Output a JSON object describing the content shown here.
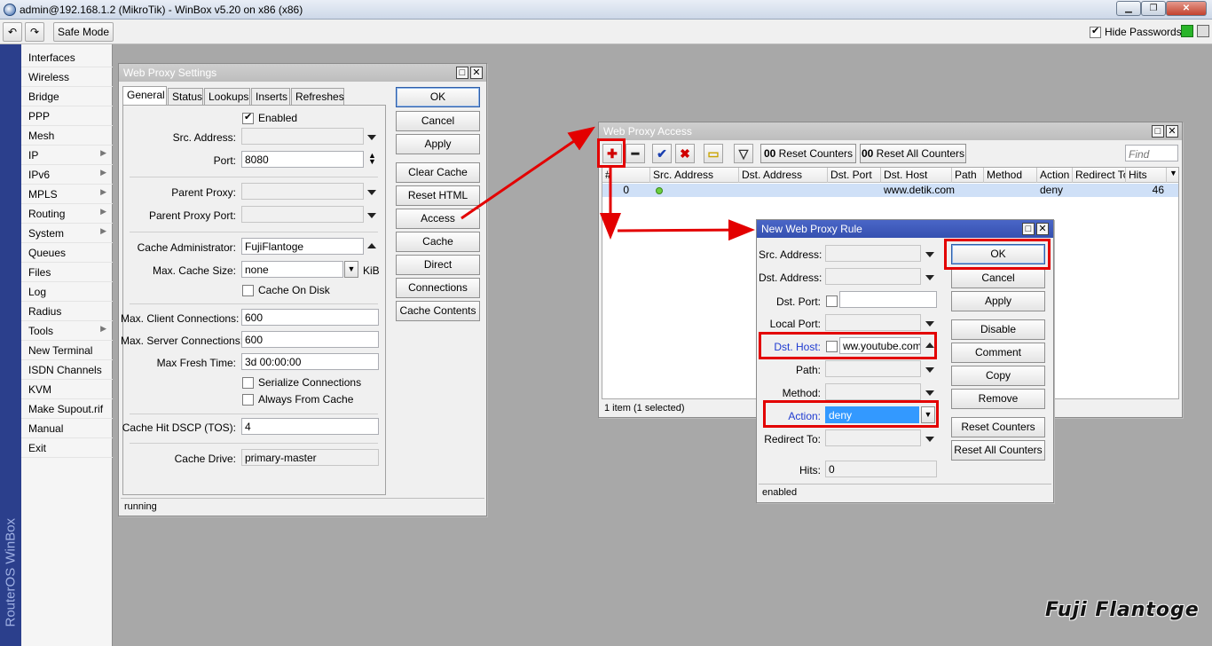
{
  "app": {
    "title": "admin@192.168.1.2 (MikroTik) - WinBox v5.20 on x86 (x86)",
    "safe_mode": "Safe Mode",
    "hide_passwords": "Hide Passwords",
    "hide_passwords_checked": true,
    "vertical_brand": "RouterOS WinBox",
    "watermark": "Fuji Flantoge"
  },
  "sidebar": {
    "items": [
      {
        "label": "Interfaces",
        "submenu": false
      },
      {
        "label": "Wireless",
        "submenu": false
      },
      {
        "label": "Bridge",
        "submenu": false
      },
      {
        "label": "PPP",
        "submenu": false
      },
      {
        "label": "Mesh",
        "submenu": false
      },
      {
        "label": "IP",
        "submenu": true
      },
      {
        "label": "IPv6",
        "submenu": true
      },
      {
        "label": "MPLS",
        "submenu": true
      },
      {
        "label": "Routing",
        "submenu": true
      },
      {
        "label": "System",
        "submenu": true
      },
      {
        "label": "Queues",
        "submenu": false
      },
      {
        "label": "Files",
        "submenu": false
      },
      {
        "label": "Log",
        "submenu": false
      },
      {
        "label": "Radius",
        "submenu": false
      },
      {
        "label": "Tools",
        "submenu": true
      },
      {
        "label": "New Terminal",
        "submenu": false
      },
      {
        "label": "ISDN Channels",
        "submenu": false
      },
      {
        "label": "KVM",
        "submenu": false
      },
      {
        "label": "Make Supout.rif",
        "submenu": false
      },
      {
        "label": "Manual",
        "submenu": false
      },
      {
        "label": "Exit",
        "submenu": false
      }
    ]
  },
  "settings": {
    "title": "Web Proxy Settings",
    "tabs": [
      "General",
      "Status",
      "Lookups",
      "Inserts",
      "Refreshes"
    ],
    "enabled_label": "Enabled",
    "src_address_label": "Src. Address:",
    "port_label": "Port:",
    "port_value": "8080",
    "parent_proxy_label": "Parent Proxy:",
    "parent_proxy_port_label": "Parent Proxy Port:",
    "cache_admin_label": "Cache Administrator:",
    "cache_admin_value": "FujiFlantoge",
    "max_cache_size_label": "Max. Cache Size:",
    "max_cache_size_value": "none",
    "max_cache_size_unit": "KiB",
    "cache_on_disk_label": "Cache On Disk",
    "max_client_conn_label": "Max. Client Connections:",
    "max_client_conn_value": "600",
    "max_server_conn_label": "Max. Server Connections:",
    "max_server_conn_value": "600",
    "max_fresh_time_label": "Max Fresh Time:",
    "max_fresh_time_value": "3d 00:00:00",
    "serialize_label": "Serialize Connections",
    "always_from_cache_label": "Always From Cache",
    "cache_hit_dscp_label": "Cache Hit DSCP (TOS):",
    "cache_hit_dscp_value": "4",
    "cache_drive_label": "Cache Drive:",
    "cache_drive_value": "primary-master",
    "buttons": [
      "OK",
      "Cancel",
      "Apply",
      "Clear Cache",
      "Reset HTML",
      "Access",
      "Cache",
      "Direct",
      "Connections",
      "Cache Contents"
    ],
    "status": "running"
  },
  "access": {
    "title": "Web Proxy Access",
    "reset_counters": "Reset Counters",
    "reset_all_counters": "Reset All Counters",
    "counter_glyph": "00",
    "find_placeholder": "Find",
    "columns": [
      "#",
      "Src. Address",
      "Dst. Address",
      "Dst. Port",
      "Dst. Host",
      "Path",
      "Method",
      "Action",
      "Redirect To",
      "Hits"
    ],
    "rows": [
      {
        "num": "0",
        "src": "",
        "dst_address": "",
        "dst_port": "",
        "dst_host": "www.detik.com",
        "path": "",
        "method": "",
        "action": "deny",
        "redirect_to": "",
        "hits": "46"
      }
    ],
    "status": "1 item (1 selected)"
  },
  "rule": {
    "title": "New Web Proxy Rule",
    "src_address_label": "Src. Address:",
    "dst_address_label": "Dst. Address:",
    "dst_port_label": "Dst. Port:",
    "local_port_label": "Local Port:",
    "dst_host_label": "Dst. Host:",
    "dst_host_value": "ww.youtube.com",
    "path_label": "Path:",
    "method_label": "Method:",
    "action_label": "Action:",
    "action_value": "deny",
    "redirect_to_label": "Redirect To:",
    "hits_label": "Hits:",
    "hits_value": "0",
    "buttons": [
      "OK",
      "Cancel",
      "Apply",
      "Disable",
      "Comment",
      "Copy",
      "Remove",
      "Reset Counters",
      "Reset All Counters"
    ],
    "status": "enabled"
  },
  "colors": {
    "annotation": "#e30000",
    "active_title": "#3550b0",
    "selection": "#3399ff"
  }
}
